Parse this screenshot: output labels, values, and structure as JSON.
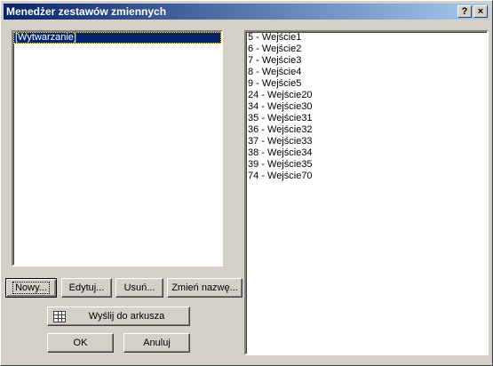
{
  "window": {
    "title": "Menedżer zestawów zmiennych",
    "help_label": "?",
    "close_label": "×"
  },
  "left_list": {
    "items": [
      {
        "label": "[Wytwarzanie]",
        "selected": true
      }
    ]
  },
  "right_list": {
    "items": [
      "5 - Wejście1",
      "6 - Wejście2",
      "7 - Wejście3",
      "8 - Wejście4",
      "9 - Wejście5",
      "24 - Wejście20",
      "34 - Wejście30",
      "35 - Wejście31",
      "36 - Wejście32",
      "37 - Wejście33",
      "38 - Wejście34",
      "39 - Wejście35",
      "74 - Wejście70"
    ]
  },
  "buttons": {
    "new": "Nowy...",
    "edit": "Edytuj...",
    "delete": "Usuń...",
    "rename": "Zmień nazwę...",
    "send": "Wyślij do arkusza",
    "ok": "OK",
    "cancel": "Anuluj"
  },
  "icons": {
    "send_icon": "spreadsheet-icon"
  }
}
